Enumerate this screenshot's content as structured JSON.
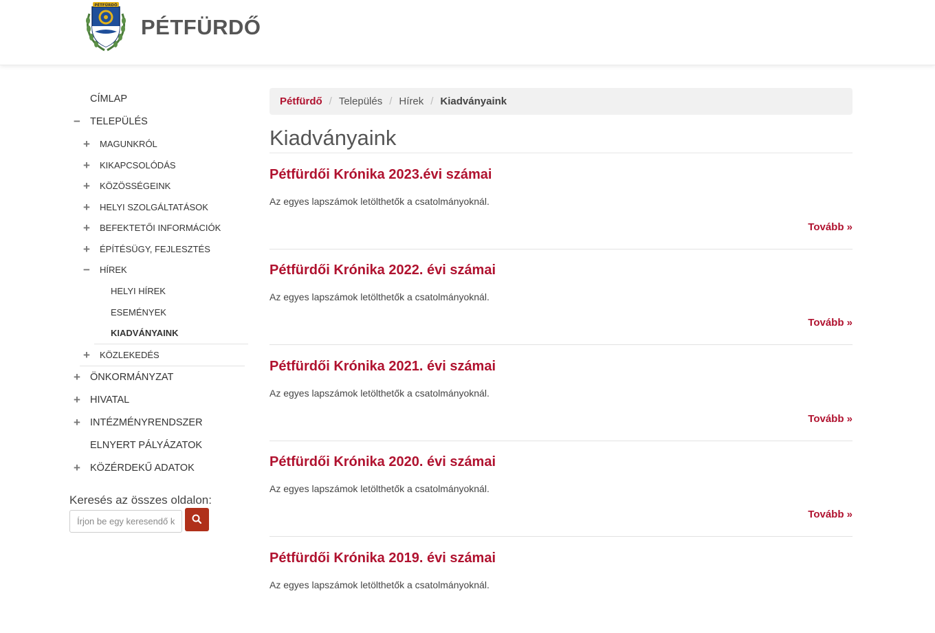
{
  "header": {
    "site_title": "PÉTFÜRDŐ",
    "logo_icon": "petfurdo-coat-of-arms-icon",
    "logo_text": "PÉTFÜRDŐ"
  },
  "sidebar": {
    "items": [
      {
        "label": "CÍMLAP",
        "level": 1,
        "sign": ""
      },
      {
        "label": "TELEPÜLÉS",
        "level": 1,
        "sign": "−"
      },
      {
        "label": "MAGUNKRÓL",
        "level": 2,
        "sign": "+"
      },
      {
        "label": "KIKAPCSOLÓDÁS",
        "level": 2,
        "sign": "+"
      },
      {
        "label": "KÖZÖSSÉGEINK",
        "level": 2,
        "sign": "+"
      },
      {
        "label": "HELYI SZOLGÁLTATÁSOK",
        "level": 2,
        "sign": "+"
      },
      {
        "label": "BEFEKTETŐI INFORMÁCIÓK",
        "level": 2,
        "sign": "+"
      },
      {
        "label": "ÉPÍTÉSÜGY, FEJLESZTÉS",
        "level": 2,
        "sign": "+"
      },
      {
        "label": "HÍREK",
        "level": 2,
        "sign": "−"
      },
      {
        "label": "HELYI HÍREK",
        "level": 3,
        "sign": ""
      },
      {
        "label": "ESEMÉNYEK",
        "level": 3,
        "sign": ""
      },
      {
        "label": "KIADVÁNYAINK",
        "level": 3,
        "sign": "",
        "active": true
      },
      {
        "label": "KÖZLEKEDÉS",
        "level": 2,
        "sign": "+"
      },
      {
        "label": "ÖNKORMÁNYZAT",
        "level": 1,
        "sign": "+"
      },
      {
        "label": "HIVATAL",
        "level": 1,
        "sign": "+"
      },
      {
        "label": "INTÉZMÉNYRENDSZER",
        "level": 1,
        "sign": "+"
      },
      {
        "label": "ELNYERT PÁLYÁZATOK",
        "level": 1,
        "sign": ""
      },
      {
        "label": "KÖZÉRDEKŰ ADATOK",
        "level": 1,
        "sign": "+"
      }
    ]
  },
  "search": {
    "label": "Keresés az összes oldalon:",
    "placeholder": "Írjon be egy keresendő kifejezést",
    "button_icon": "search-icon"
  },
  "breadcrumb": {
    "home": "Pétfürdő",
    "level1": "Település",
    "level2": "Hírek",
    "current": "Kiadványaink",
    "separator": "/"
  },
  "main": {
    "title": "Kiadványaink",
    "articles": [
      {
        "title": "Pétfürdői Krónika 2023.évi számai",
        "summary": "Az egyes lapszámok letölthetők a csatolmányoknál.",
        "more": "Tovább »"
      },
      {
        "title": "Pétfürdői Krónika 2022. évi számai",
        "summary": "Az egyes lapszámok letölthetők a csatolmányoknál.",
        "more": "Tovább »"
      },
      {
        "title": "Pétfürdői Krónika 2021. évi számai",
        "summary": "Az egyes lapszámok letölthetők a csatolmányoknál.",
        "more": "Tovább »"
      },
      {
        "title": "Pétfürdői Krónika 2020. évi számai",
        "summary": "Az egyes lapszámok letölthetők a csatolmányoknál.",
        "more": "Tovább »"
      },
      {
        "title": "Pétfürdői Krónika 2019. évi számai",
        "summary": "Az egyes lapszámok letölthetők a csatolmányoknál.",
        "more": ""
      }
    ]
  },
  "colors": {
    "accent": "#b0122f",
    "search_button": "#b0301a",
    "breadcrumb_bg": "#f1f1f1"
  }
}
